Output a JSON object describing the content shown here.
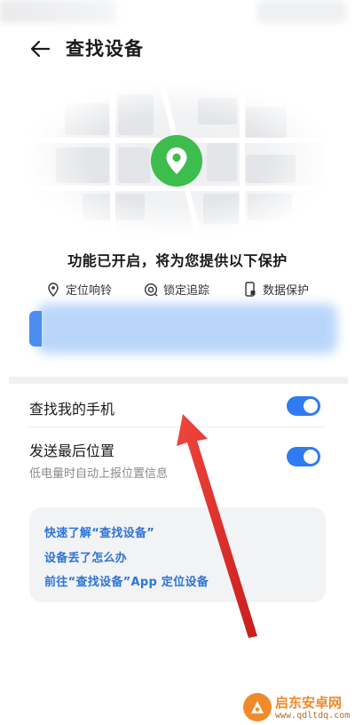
{
  "header": {
    "title": "查找设备",
    "back_icon": "arrow-left-icon"
  },
  "map": {
    "pin_icon": "location-pin-icon",
    "pin_color": "#3cbd4e"
  },
  "info": {
    "title": "功能已开启，将为您提供以下保护",
    "features": [
      {
        "icon": "location-pin-icon",
        "label": "定位响铃"
      },
      {
        "icon": "lock-target-icon",
        "label": "锁定追踪"
      },
      {
        "icon": "phone-lock-icon",
        "label": "数据保护"
      }
    ]
  },
  "settings": {
    "find_my_phone": {
      "label": "查找我的手机",
      "enabled": true
    },
    "send_last_location": {
      "label": "发送最后位置",
      "sub": "低电量时自动上报位置信息",
      "enabled": true
    }
  },
  "help": {
    "links": [
      "快速了解“查找设备”",
      "设备丢了怎么办",
      "前往“查找设备”App 定位设备"
    ]
  },
  "colors": {
    "accent": "#2f7bf0",
    "link": "#2d74d6",
    "annotation_arrow": "#e8302a"
  },
  "watermark": {
    "name": "启东安卓网",
    "url": "www.qdltdq.com"
  }
}
